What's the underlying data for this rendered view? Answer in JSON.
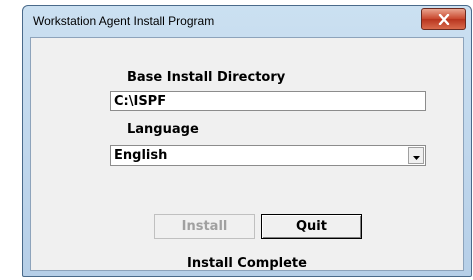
{
  "window": {
    "title": "Workstation Agent Install Program",
    "close_icon": "close-icon"
  },
  "form": {
    "directory_label": "Base Install Directory",
    "directory_value": "C:\\ISPF",
    "language_label": "Language",
    "language_value": "English",
    "dropdown_icon": "chevron-down-icon"
  },
  "buttons": {
    "install_label": "Install",
    "install_enabled": false,
    "quit_label": "Quit"
  },
  "status": {
    "text": "Install Complete"
  },
  "colors": {
    "title_bar": "#cbe0f1",
    "close_button": "#c8462c",
    "dialog_background": "#f0f0f0"
  }
}
